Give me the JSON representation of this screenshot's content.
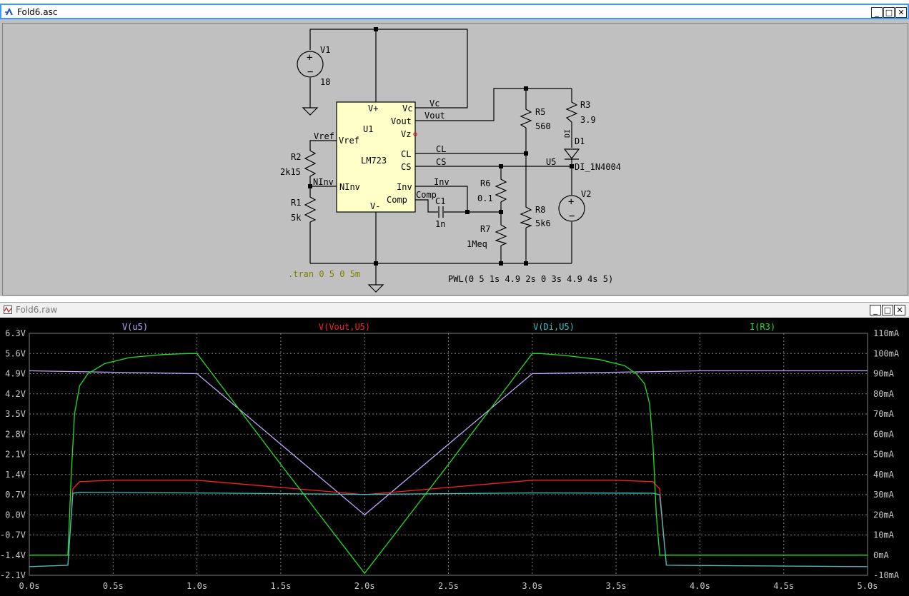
{
  "schematic_window": {
    "title": "Fold6.asc",
    "spice_directive": ".tran 0 5 0 5m",
    "pwl_source": "PWL(0 5 1s 4.9 2s 0 3s 4.9 4s 5)",
    "components": {
      "v1": {
        "name": "V1",
        "value": "18"
      },
      "v2": {
        "name": "V2"
      },
      "u1": {
        "name": "U1",
        "model": "LM723",
        "pins": {
          "vplus": "V+",
          "vminus": "V-",
          "vc": "Vc",
          "vout": "Vout",
          "vz": "Vz",
          "cl": "CL",
          "cs": "CS",
          "inv": "Inv",
          "comp": "Comp",
          "vref": "Vref",
          "ninv": "NInv"
        }
      },
      "r1": {
        "name": "R1",
        "value": "5k"
      },
      "r2": {
        "name": "R2",
        "value": "2k15"
      },
      "r3": {
        "name": "R3",
        "value": "3.9"
      },
      "r5": {
        "name": "R5",
        "value": "560"
      },
      "r6": {
        "name": "R6",
        "value": "0.1"
      },
      "r7": {
        "name": "R7",
        "value": "1Meq"
      },
      "r8": {
        "name": "R8",
        "value": "5k6"
      },
      "c1": {
        "name": "C1",
        "value": "1n"
      },
      "d1": {
        "name": "D1",
        "value": "DI_1N4004",
        "marker": "DI"
      }
    },
    "net_labels": {
      "vc": "Vc",
      "vout": "Vout",
      "vref": "Vref",
      "ninv": "NInv",
      "cl": "CL",
      "cs": "CS",
      "inv": "Inv",
      "comp": "Comp",
      "u5": "U5"
    }
  },
  "waveform_window": {
    "title": "Fold6.raw"
  },
  "colors": {
    "v_u5": "#c4a8ff",
    "v_vout_u5": "#ff2020",
    "v_di_u5": "#30c8c8",
    "i_r3": "#20e020",
    "plot_bg": "#000000",
    "grid": "#808080"
  },
  "chart_data": {
    "type": "line",
    "title": "",
    "xlabel": "",
    "ylabel": "",
    "xlim": [
      0,
      5
    ],
    "ylim": [
      -2.1,
      6.3
    ],
    "y2lim": [
      -10,
      110
    ],
    "x_ticks": [
      "0.0s",
      "0.5s",
      "1.0s",
      "1.5s",
      "2.0s",
      "2.5s",
      "3.0s",
      "3.5s",
      "4.0s",
      "4.5s",
      "5.0s"
    ],
    "y_ticks": [
      "6.3V",
      "5.6V",
      "4.9V",
      "4.2V",
      "3.5V",
      "2.8V",
      "2.1V",
      "1.4V",
      "0.7V",
      "0.0V",
      "-0.7V",
      "-1.4V",
      "-2.1V"
    ],
    "y2_ticks": [
      "110mA",
      "100mA",
      "90mA",
      "80mA",
      "70mA",
      "60mA",
      "50mA",
      "40mA",
      "30mA",
      "20mA",
      "10mA",
      "0mA",
      "-10mA"
    ],
    "series": [
      {
        "name": "V(u5)",
        "axis": "left",
        "x": [
          0,
          1,
          2,
          3,
          4,
          5
        ],
        "y": [
          5.0,
          4.9,
          0.0,
          4.9,
          5.0,
          5.0
        ]
      },
      {
        "name": "V(Vout,U5)",
        "axis": "left",
        "x": [
          0,
          0.23,
          0.26,
          0.3,
          0.5,
          1.0,
          1.5,
          2.0,
          2.5,
          3.0,
          3.5,
          3.72,
          3.76,
          3.8,
          5.0
        ],
        "y": [
          -1.8,
          -1.75,
          0.9,
          1.15,
          1.2,
          1.2,
          0.95,
          0.7,
          0.95,
          1.2,
          1.2,
          1.15,
          0.9,
          -1.75,
          -1.8
        ]
      },
      {
        "name": "V(Di,U5)",
        "axis": "left",
        "x": [
          0,
          0.23,
          0.26,
          0.3,
          1.0,
          2.0,
          3.0,
          3.72,
          3.76,
          3.8,
          5.0
        ],
        "y": [
          -1.8,
          -1.75,
          0.75,
          0.78,
          0.76,
          0.71,
          0.76,
          0.75,
          0.7,
          -1.75,
          -1.8
        ]
      },
      {
        "name": "I(R3)",
        "axis": "right",
        "x": [
          0,
          0.23,
          0.25,
          0.27,
          0.3,
          0.35,
          0.45,
          0.6,
          0.8,
          0.95,
          1.0,
          1.5,
          2.0,
          2.5,
          3.0,
          3.05,
          3.2,
          3.4,
          3.55,
          3.62,
          3.67,
          3.7,
          3.72,
          3.74,
          3.76,
          5.0
        ],
        "y": [
          0,
          0,
          40,
          70,
          84,
          90,
          95,
          98,
          99.5,
          100,
          100,
          45,
          -9,
          45,
          100,
          100,
          99,
          97,
          94,
          90,
          85,
          75,
          55,
          20,
          0,
          0
        ]
      }
    ]
  }
}
